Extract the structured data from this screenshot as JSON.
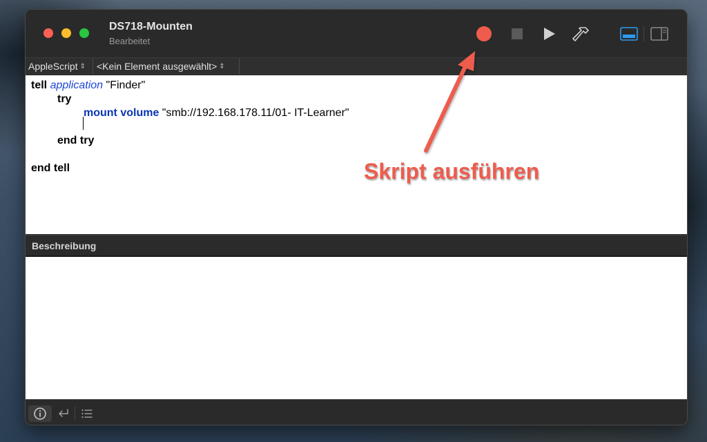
{
  "window": {
    "title": "DS718-Mounten",
    "subtitle": "Bearbeitet"
  },
  "toolbar": {
    "icons": [
      "record-icon",
      "stop-icon",
      "play-icon",
      "hammer-icon",
      "bottom-panel-icon",
      "side-panel-icon"
    ],
    "record_color": "#ee5c4e"
  },
  "navigator": {
    "language": "AppleScript",
    "element": "<Kein Element ausgewählt>"
  },
  "code": {
    "line1_kw": "tell",
    "line1_app": "application",
    "line1_str": "\"Finder\"",
    "line2_kw": "try",
    "line3_cmd": "mount volume",
    "line3_str": "\"smb://192.168.178.11/01- IT-Learner\"",
    "line5_kw": "end try",
    "line7_kw": "end tell"
  },
  "description": {
    "header": "Beschreibung"
  },
  "bottom_bar": {
    "icons": [
      "info-icon",
      "return-icon",
      "list-icon"
    ]
  },
  "annotation": {
    "label": "Skript ausführen",
    "color": "#ee5c4e"
  }
}
